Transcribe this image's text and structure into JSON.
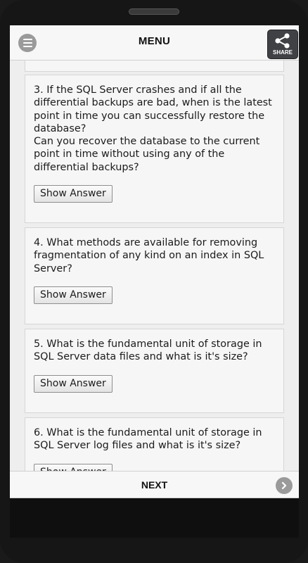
{
  "header": {
    "menu_icon": "hamburger-menu-icon",
    "title": "MENU",
    "share_label": "SHARE",
    "share_icon": "share-icon"
  },
  "questions": [
    {
      "text": "3. If the SQL Server crashes and if all the differential backups are bad, when is the latest point in time you can successfully restore the database?\nCan you recover the database to the current point in time without using any of the differential backups?",
      "button": "Show Answer"
    },
    {
      "text": "4. What methods are available for removing fragmentation of any kind on an index in SQL Server?",
      "button": "Show Answer"
    },
    {
      "text": "5. What is the fundamental unit of storage in SQL Server data files and what is it's size?",
      "button": "Show Answer"
    },
    {
      "text": "6. What is the fundamental unit of storage in SQL Server log files and what is it's size?",
      "button": "Show Answer"
    }
  ],
  "footer": {
    "next_label": "NEXT",
    "next_icon": "chevron-right-icon"
  }
}
